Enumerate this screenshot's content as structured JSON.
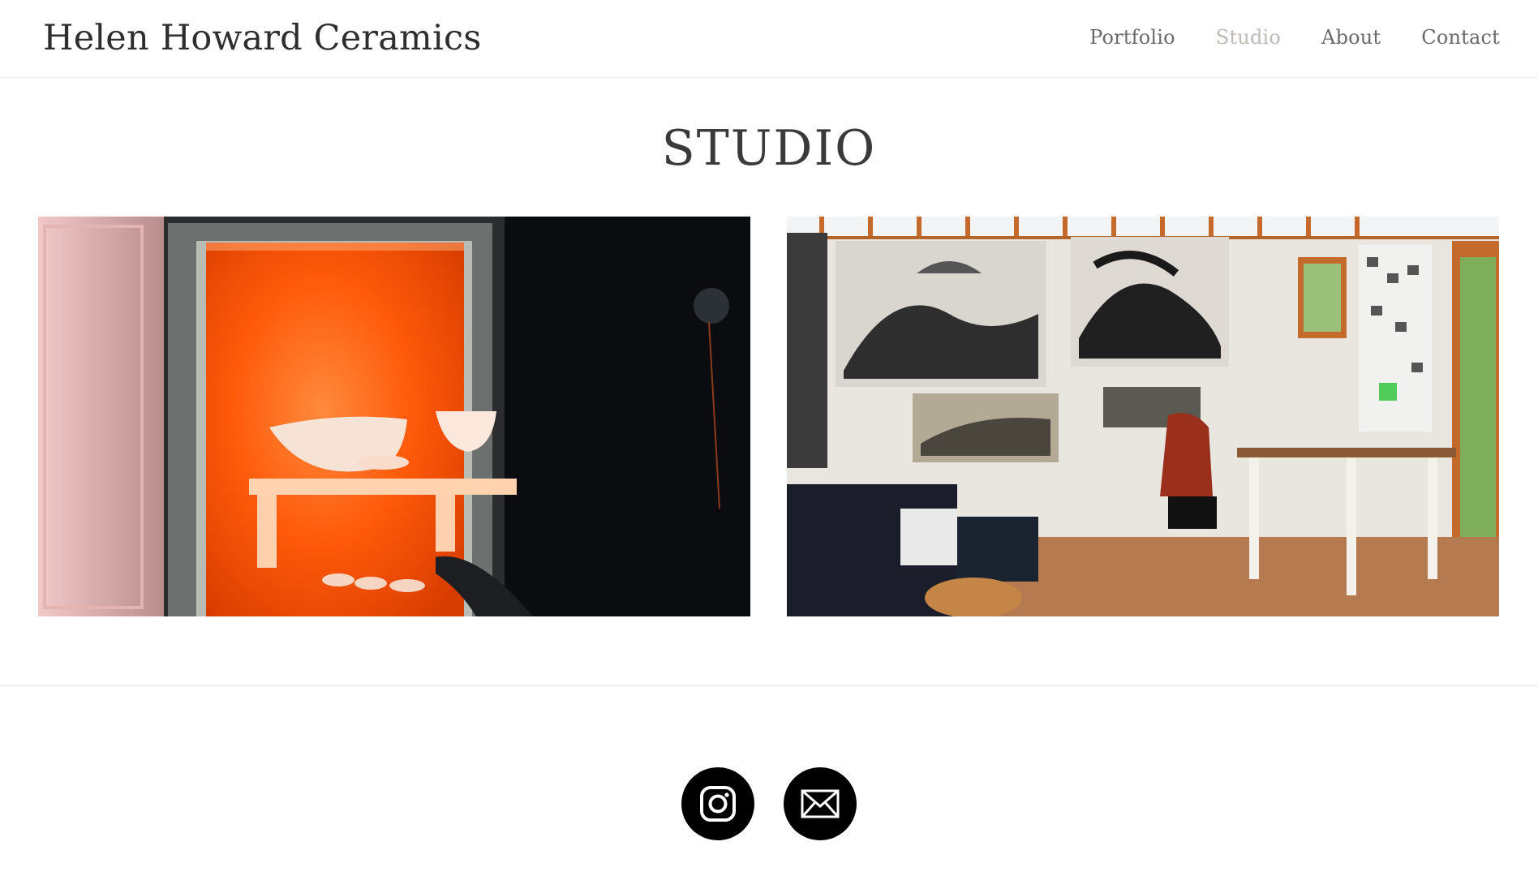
{
  "site": {
    "title": "Helen Howard Ceramics"
  },
  "nav": {
    "items": [
      {
        "label": "Portfolio",
        "active": false
      },
      {
        "label": "Studio",
        "active": true
      },
      {
        "label": "About",
        "active": false
      },
      {
        "label": "Contact",
        "active": false
      }
    ]
  },
  "page": {
    "heading": "STUDIO"
  },
  "gallery": {
    "images": [
      {
        "subject": "glowing kiln interior with ceramic bowls"
      },
      {
        "subject": "artist studio with charcoal drawings, desk and chair"
      }
    ]
  },
  "footer": {
    "social": [
      {
        "icon": "instagram-icon"
      },
      {
        "icon": "email-icon"
      }
    ]
  },
  "colors": {
    "nav_active": "#bdb9b4",
    "nav_default": "#6a6a6a",
    "kiln_glow": "#ff5a0a"
  }
}
